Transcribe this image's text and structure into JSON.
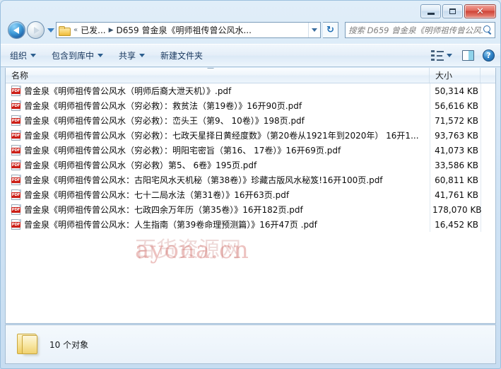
{
  "window": {
    "controls": {
      "minimize": "–",
      "maximize": "□",
      "close": "✕"
    }
  },
  "nav": {
    "back_label": "后退",
    "forward_label": "前进",
    "history_label": "最近的位置"
  },
  "address": {
    "folder_icon": "folder-icon",
    "crumb_overflow": "«",
    "crumbs": [
      {
        "label": "已发..."
      },
      {
        "label": "D659 曾金泉《明师祖传曾公风水..."
      }
    ],
    "separator": "▶",
    "dropdown_icon": "chevron-down-icon",
    "refresh_icon": "↻"
  },
  "search": {
    "placeholder": "搜索 D659 曾金泉《明师祖传曾公风...",
    "value": "",
    "icon": "search-icon"
  },
  "toolbar": {
    "items": [
      {
        "label": "组织",
        "has_caret": true
      },
      {
        "label": "包含到库中",
        "has_caret": true
      },
      {
        "label": "共享",
        "has_caret": true
      },
      {
        "label": "新建文件夹",
        "has_caret": false
      }
    ],
    "view_icon": "view-options-icon",
    "view_caret": "chevron-down-icon",
    "preview_pane_icon": "preview-pane-icon",
    "help_icon": "help-icon",
    "help_glyph": "?"
  },
  "list": {
    "columns": [
      {
        "key": "name",
        "label": "名称"
      },
      {
        "key": "size",
        "label": "大小"
      }
    ],
    "sort_indicator": "sort-ascending-icon",
    "rows": [
      {
        "icon": "pdf-file-icon",
        "badge": "PDF",
        "name": "曾金泉《明师祖传曾公风水（明师后裔大泄天机）》.pdf",
        "size": "50,314 KB"
      },
      {
        "icon": "pdf-file-icon",
        "badge": "PDF",
        "name": "曾金泉《明师祖传曾公风水（穷必救）：救贫法（第19卷）》16开90页.pdf",
        "size": "56,616 KB"
      },
      {
        "icon": "pdf-file-icon",
        "badge": "PDF",
        "name": "曾金泉《明师祖传曾公风水（穷必救）：峦头王（第9、 10卷）》198页.pdf",
        "size": "71,572 KB"
      },
      {
        "icon": "pdf-file-icon",
        "badge": "PDF",
        "name": "曾金泉《明师祖传曾公风水（穷必救）：七政天星择日黄经度数》（第20卷从1921年到2020年） 16开1...",
        "size": "93,763 KB"
      },
      {
        "icon": "pdf-file-icon",
        "badge": "PDF",
        "name": "曾金泉《明师祖传曾公风水（穷必救）：明阳宅密旨（第16、 17卷）》16开69页.pdf",
        "size": "41,073 KB"
      },
      {
        "icon": "pdf-file-icon",
        "badge": "PDF",
        "name": "曾金泉《明师祖传曾公风水（穷必救）第5、 6卷》195页.pdf",
        "size": "33,586 KB"
      },
      {
        "icon": "pdf-file-icon",
        "badge": "PDF",
        "name": "曾金泉《明师祖传曾公风水：古阳宅风水天机秘（第38卷）》珍藏古版风水秘笈!16开100页.pdf",
        "size": "60,811 KB"
      },
      {
        "icon": "pdf-file-icon",
        "badge": "PDF",
        "name": "曾金泉《明师祖传曾公风水：七十二局水法（第31卷）》16开63页.pdf",
        "size": "41,761 KB"
      },
      {
        "icon": "pdf-file-icon",
        "badge": "PDF",
        "name": "曾金泉《明师祖传曾公风水：七政四余万年历（第35卷）》16开182页.pdf",
        "size": "178,070 KB"
      },
      {
        "icon": "pdf-file-icon",
        "badge": "PDF",
        "name": "曾金泉《明师祖传曾公风水：人生指南（第39卷命理预测篇）》16开47页 .pdf",
        "size": "16,452 KB"
      }
    ]
  },
  "watermark": {
    "latin": "ayona.cn",
    "chinese": "百货资源网"
  },
  "status": {
    "folder_icon": "folder-icon",
    "text": "10 个对象"
  },
  "colors": {
    "accent": "#1f63a8",
    "pdf_red": "#cc1f17",
    "close_red": "#cf4336",
    "folder_yellow": "#f7cf64",
    "frame_blue": "#9cc0de"
  }
}
